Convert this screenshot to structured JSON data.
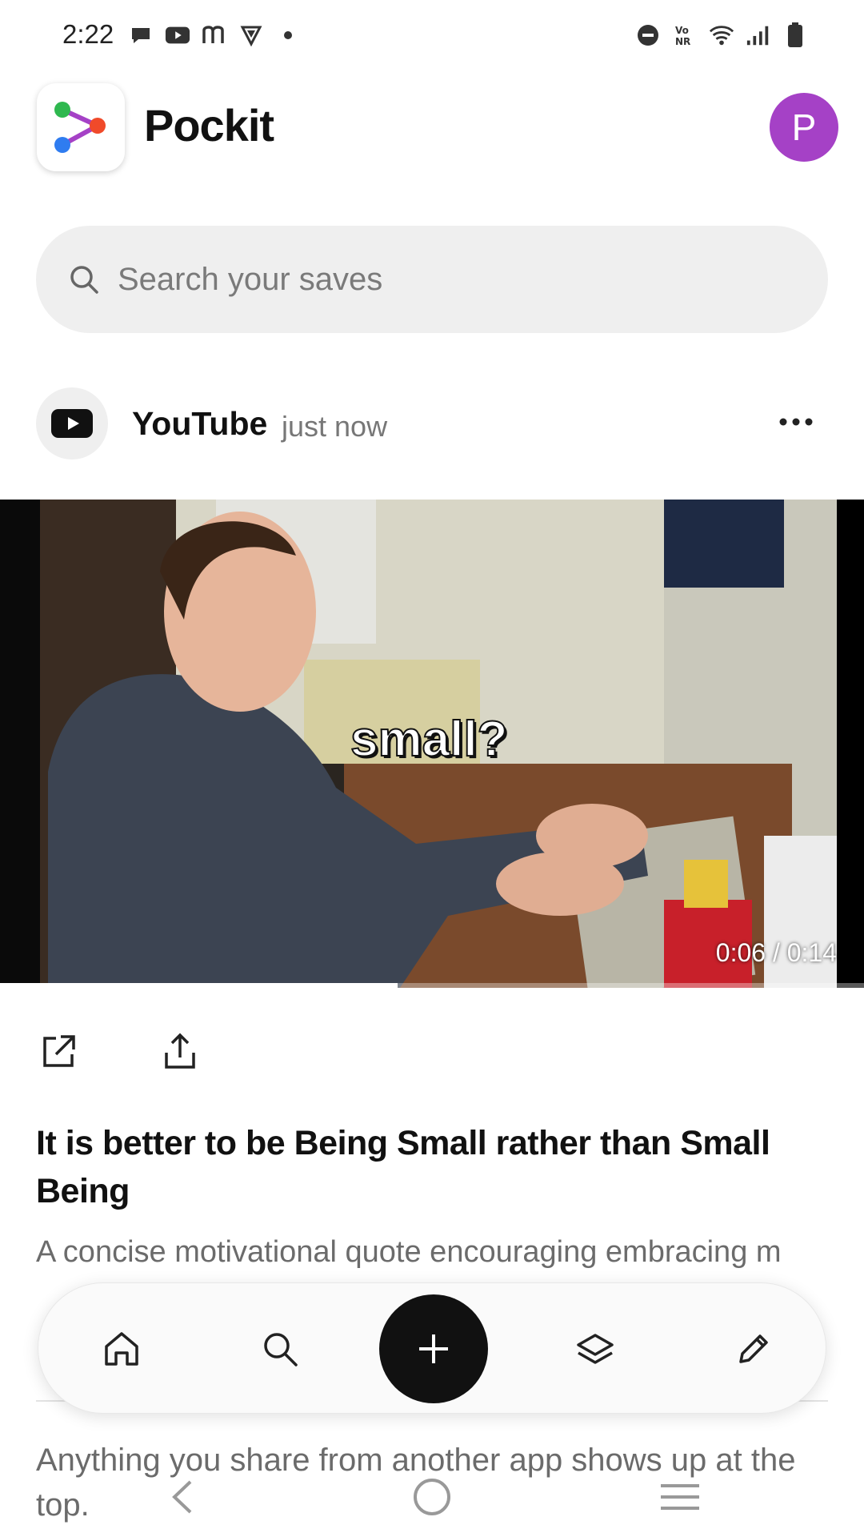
{
  "status_bar": {
    "time": "2:22",
    "left_icons": [
      "chat-icon",
      "youtube-icon",
      "m-icon",
      "vpn-shield-icon",
      "dot-icon"
    ],
    "right_icons": [
      "dnd-icon",
      "vonr-icon",
      "wifi-icon",
      "signal-icon",
      "battery-icon"
    ],
    "vonr_label": "Vo NR"
  },
  "header": {
    "app_name": "Pockit",
    "avatar_initial": "P",
    "avatar_color": "#a541c6"
  },
  "search": {
    "placeholder": "Search your saves"
  },
  "card": {
    "source": "YouTube",
    "time": "just now",
    "video": {
      "caption": "small?",
      "timer": "0:06 / 0:14",
      "progress": 0.46
    },
    "title": "It is better to be Being Small rather than Small Being",
    "description": "A concise motivational quote encouraging embracing m"
  },
  "footer": {
    "hint": "Anything you share from another app shows up at the top."
  },
  "bottom_nav": {
    "items": [
      "home-icon",
      "search-icon",
      "add-icon",
      "layers-icon",
      "edit-icon"
    ]
  },
  "colors": {
    "accent": "#111111",
    "avatar": "#a541c6",
    "search_bg": "#efefef"
  }
}
